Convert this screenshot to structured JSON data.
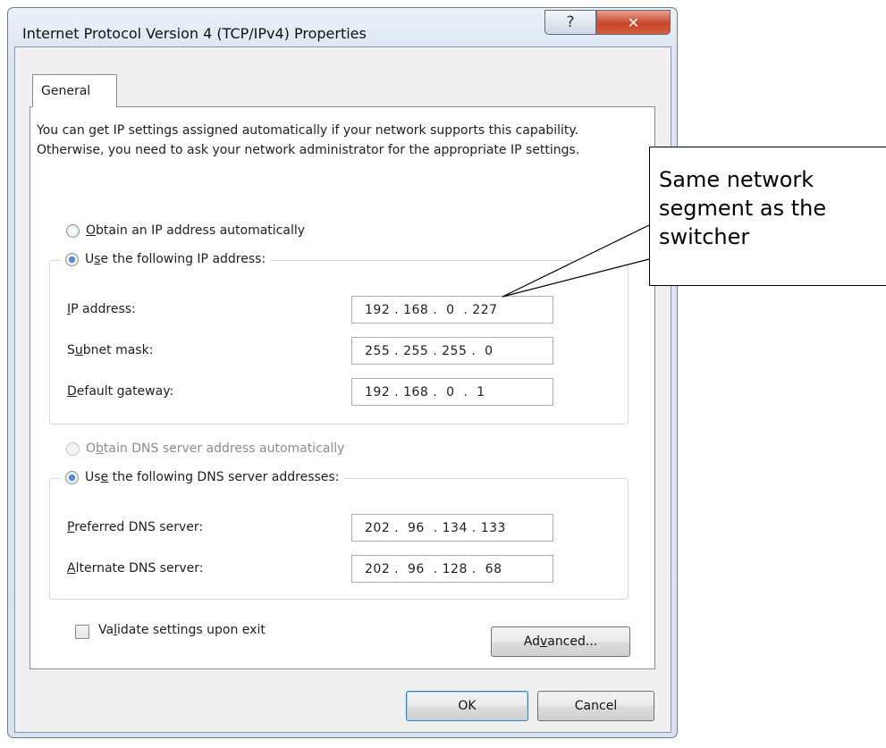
{
  "window": {
    "title": "Internet Protocol Version 4 (TCP/IPv4) Properties",
    "help_glyph": "?",
    "close_glyph": "✕"
  },
  "tab": {
    "label": "General"
  },
  "description": "You can get IP settings assigned automatically if your network supports this capability. Otherwise, you need to ask your network administrator for the appropriate IP settings.",
  "ip": {
    "auto": {
      "pre": "",
      "key": "O",
      "post": "btain an IP address automatically",
      "selected": false
    },
    "manual": {
      "pre": "U",
      "key": "s",
      "post": "e the following IP address:",
      "selected": true
    },
    "fields": [
      {
        "pre": "",
        "key": "I",
        "post": "P address:",
        "value": "192 . 168 .  0  . 227"
      },
      {
        "pre": "S",
        "key": "u",
        "post": "bnet mask:",
        "value": "255 . 255 . 255 .  0"
      },
      {
        "pre": "",
        "key": "D",
        "post": "efault gateway:",
        "value": "192 . 168 .  0  .  1"
      }
    ]
  },
  "dns": {
    "auto": {
      "pre": "O",
      "key": "b",
      "post": "tain DNS server address automatically",
      "selected": false,
      "disabled": true
    },
    "manual": {
      "pre": "Us",
      "key": "e",
      "post": " the following DNS server addresses:",
      "selected": true
    },
    "fields": [
      {
        "pre": "",
        "key": "P",
        "post": "referred DNS server:",
        "value": "202 .  96  . 134 . 133"
      },
      {
        "pre": "",
        "key": "A",
        "post": "lternate DNS server:",
        "value": "202 .  96  . 128 .  68"
      }
    ]
  },
  "validate": {
    "pre": "Va",
    "key": "l",
    "post": "idate settings upon exit",
    "checked": false
  },
  "buttons": {
    "advanced": {
      "pre": "Ad",
      "key": "v",
      "post": "anced..."
    },
    "ok": "OK",
    "cancel": "Cancel"
  },
  "callout": {
    "text": "Same network segment as the switcher"
  }
}
